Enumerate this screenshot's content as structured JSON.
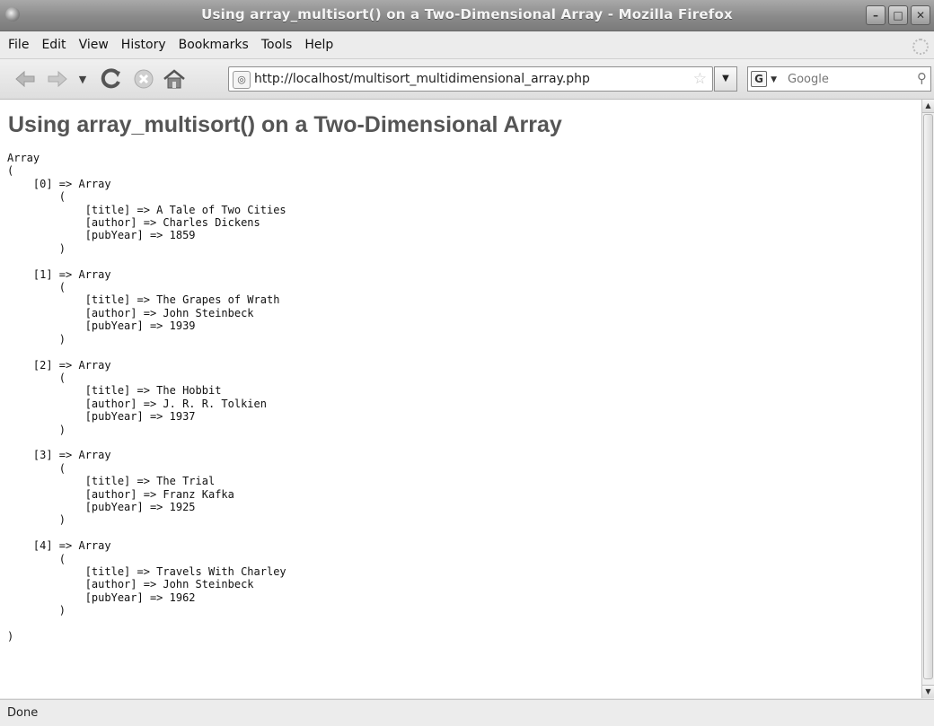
{
  "window": {
    "title": "Using array_multisort() on a Two-Dimensional Array - Mozilla Firefox",
    "minimize_icon": "minimize-icon",
    "maximize_icon": "maximize-icon",
    "close_icon": "close-icon"
  },
  "menu": {
    "items": [
      "File",
      "Edit",
      "View",
      "History",
      "Bookmarks",
      "Tools",
      "Help"
    ]
  },
  "navigation": {
    "url": "http://localhost/multisort_multidimensional_array.php",
    "search_placeholder": "Google",
    "search_engine": "G"
  },
  "page": {
    "heading": "Using array_multisort() on a Two-Dimensional Array",
    "output": "Array\n(\n    [0] => Array\n        (\n            [title] => A Tale of Two Cities\n            [author] => Charles Dickens\n            [pubYear] => 1859\n        )\n\n    [1] => Array\n        (\n            [title] => The Grapes of Wrath\n            [author] => John Steinbeck\n            [pubYear] => 1939\n        )\n\n    [2] => Array\n        (\n            [title] => The Hobbit\n            [author] => J. R. R. Tolkien\n            [pubYear] => 1937\n        )\n\n    [3] => Array\n        (\n            [title] => The Trial\n            [author] => Franz Kafka\n            [pubYear] => 1925\n        )\n\n    [4] => Array\n        (\n            [title] => Travels With Charley\n            [author] => John Steinbeck\n            [pubYear] => 1962\n        )\n\n)"
  },
  "status": {
    "text": "Done"
  }
}
